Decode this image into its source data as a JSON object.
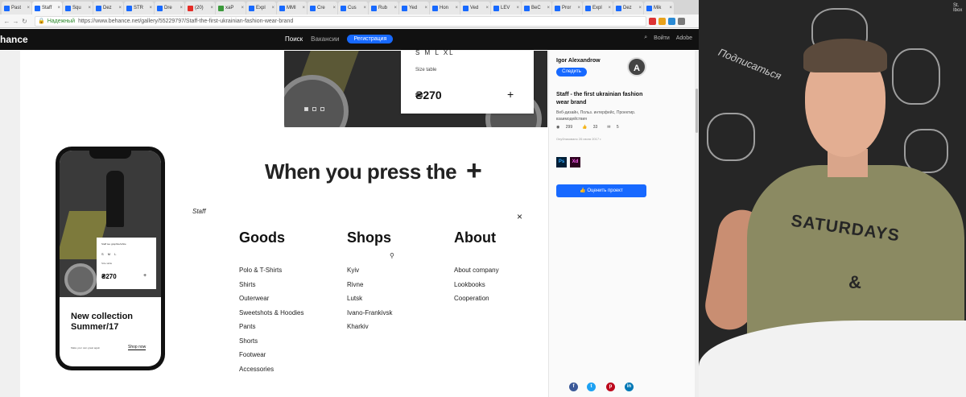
{
  "browser": {
    "tabs": [
      {
        "label": "Past",
        "icon": "blue"
      },
      {
        "label": "Staff",
        "icon": "blue",
        "active": true
      },
      {
        "label": "Squ",
        "icon": "blue"
      },
      {
        "label": "Dez",
        "icon": "blue"
      },
      {
        "label": "STR",
        "icon": "blue"
      },
      {
        "label": "Dre",
        "icon": "blue"
      },
      {
        "label": "(20)",
        "icon": "red"
      },
      {
        "label": "xaP",
        "icon": "green"
      },
      {
        "label": "Expl",
        "icon": "blue"
      },
      {
        "label": "MMI",
        "icon": "blue"
      },
      {
        "label": "Cre",
        "icon": "blue"
      },
      {
        "label": "Cus",
        "icon": "blue"
      },
      {
        "label": "Rub",
        "icon": "blue"
      },
      {
        "label": "Yed",
        "icon": "blue"
      },
      {
        "label": "Hon",
        "icon": "blue"
      },
      {
        "label": "Ved",
        "icon": "blue"
      },
      {
        "label": "LEV",
        "icon": "blue"
      },
      {
        "label": "BeC",
        "icon": "blue"
      },
      {
        "label": "Pror",
        "icon": "blue"
      },
      {
        "label": "Expl",
        "icon": "blue"
      },
      {
        "label": "Dez",
        "icon": "blue"
      },
      {
        "label": "Mik",
        "icon": "blue"
      }
    ],
    "secure_label": "Надежный",
    "url": "https://www.behance.net/gallery/55229797/Staff-the-first-ukrainian-fashion-wear-brand"
  },
  "behance": {
    "logo": "hance",
    "nav_search": "Поиск",
    "nav_jobs": "Вакансии",
    "register": "Регистрация",
    "login": "Войти",
    "adobe": "Adobe"
  },
  "product_card": {
    "sizes": "S M L XL",
    "size_table": "Size table",
    "price": "₴270",
    "plus": "+"
  },
  "phone": {
    "mini_title": "Staff tee graphite/white",
    "mini_sizes": "S M L",
    "mini_table": "Size table",
    "mini_price": "₴270",
    "mini_plus": "+",
    "collection_line1": "New collection",
    "collection_line2": "Summer/17",
    "tagline": "Make your own great again",
    "shop_now": "Shop now"
  },
  "menu": {
    "heading": "When you press the",
    "plus": "+",
    "logo": "Staff",
    "close": "×",
    "columns": [
      {
        "title": "Goods",
        "items": [
          "Polo & T-Shirts",
          "Shirts",
          "Outerwear",
          "Sweetshots & Hoodies",
          "Pants",
          "Shorts",
          "Footwear",
          "Accessories"
        ]
      },
      {
        "title": "Shops",
        "items": [
          "Kyiv",
          "Rivne",
          "Lutsk",
          "Ivano-Frankivsk",
          "Kharkiv"
        ]
      },
      {
        "title": "About",
        "items": [
          "About company",
          "Lookbooks",
          "Cooperation"
        ]
      }
    ]
  },
  "sidebar": {
    "author": "Igor Alexandrow",
    "follow": "Следить",
    "avatar_letter": "A",
    "project_title": "Staff - the first ukrainian fashion wear brand",
    "categories": "Веб-дизайн, Польз. интерфейс, Проектир. взаимодействия",
    "views": "299",
    "likes": "33",
    "comments": "5",
    "published": "Опубликовано 26 июля 2017 г.",
    "tool1": "Ps",
    "tool2": "Xd",
    "appreciate": "Оценить проект",
    "share_icons": [
      "facebook",
      "twitter",
      "pinterest",
      "linkedin"
    ]
  },
  "video": {
    "subscribe": "Подписаться",
    "shirt_line": "SATURDAYS",
    "shirt_amp": "&",
    "corner_text": "St. Ibox"
  },
  "colors": {
    "behance_blue": "#1769ff",
    "header_black": "#111111",
    "shirt_olive": "#8b8a62"
  }
}
